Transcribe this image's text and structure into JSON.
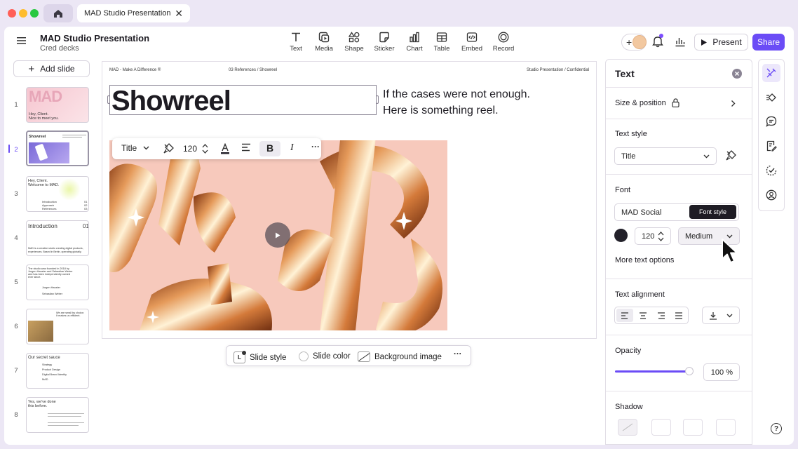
{
  "browser": {
    "tab_title": "MAD Studio Presentation",
    "tab_close": "✕"
  },
  "colors": {
    "accent": "#6b4cf6",
    "traffic_red": "#ff5f57",
    "traffic_yellow": "#febc2e",
    "traffic_green": "#28c840",
    "text_color_swatch": "#23212a"
  },
  "header": {
    "title": "MAD Studio Presentation",
    "subtitle": "Cred decks",
    "tools": [
      {
        "label": "Text",
        "icon": "text-icon"
      },
      {
        "label": "Media",
        "icon": "media-icon"
      },
      {
        "label": "Shape",
        "icon": "shape-icon"
      },
      {
        "label": "Sticker",
        "icon": "sticker-icon"
      },
      {
        "label": "Chart",
        "icon": "chart-icon"
      },
      {
        "label": "Table",
        "icon": "table-icon"
      },
      {
        "label": "Embed",
        "icon": "embed-icon"
      },
      {
        "label": "Record",
        "icon": "record-icon"
      }
    ],
    "add_collaborator": "+",
    "present_label": "Present",
    "share_label": "Share"
  },
  "sidebar": {
    "add_slide_label": "Add slide",
    "active_slide": 2,
    "slides": [
      {
        "number": "1",
        "lines": [
          "MAD",
          "Hey, Client.",
          "Nice to meet you."
        ]
      },
      {
        "number": "2",
        "lines": [
          "Showreel"
        ]
      },
      {
        "number": "3",
        "lines": [
          "Hey, Client.",
          "Welcome to MAD.",
          "Introduction",
          "Approach",
          "References",
          "01",
          "02",
          "03"
        ]
      },
      {
        "number": "4",
        "lines": [
          "Introduction",
          "01",
          "MAD is a creative studio creating digital products,",
          "experiences. Based in Berlin, operating globally."
        ]
      },
      {
        "number": "5",
        "lines": [
          "The studio was founded in 2018 by",
          "Jurgen Hauster and Sebastian Weber",
          "and has been independently owned",
          "ever since.",
          "Jurgen Hauster",
          "Sebastian Weber"
        ]
      },
      {
        "number": "6",
        "lines": [
          "We are small by choice.",
          "It makes us efficient."
        ]
      },
      {
        "number": "7",
        "lines": [
          "Our secret sauce",
          "Strategy",
          "Product Design",
          "Digital Brand Identity",
          "MAD"
        ]
      },
      {
        "number": "8",
        "lines": [
          "Yes, we've done",
          "this before."
        ]
      }
    ]
  },
  "slide": {
    "header_left": "MAD - Make A Difference ®",
    "header_center": "03 References / Showreel",
    "header_right": "Studio Presentation / Confidential",
    "title": "Showreel",
    "body_line1": "If the cases were not enough.",
    "body_line2": "Here is something reel."
  },
  "floating_toolbar": {
    "style_value": "Title",
    "font_size": "120",
    "bold_label": "B",
    "italic_label": "I",
    "more_label": "···"
  },
  "bottom_bar": {
    "slide_style_label": "Slide style",
    "slide_style_badge": "L",
    "slide_color_label": "Slide color",
    "background_image_label": "Background image",
    "more_label": "···"
  },
  "panel": {
    "title": "Text",
    "size_position_label": "Size & position",
    "text_style_label": "Text style",
    "text_style_value": "Title",
    "font_label": "Font",
    "font_value": "MAD Social",
    "font_size_value": "120",
    "font_weight_value": "Medium",
    "tooltip": "Font style",
    "more_text_options": "More text options",
    "text_alignment_label": "Text alignment",
    "opacity_label": "Opacity",
    "opacity_value": "100 %",
    "opacity_fraction": 1.0,
    "shadow_label": "Shadow"
  },
  "help_label": "?"
}
